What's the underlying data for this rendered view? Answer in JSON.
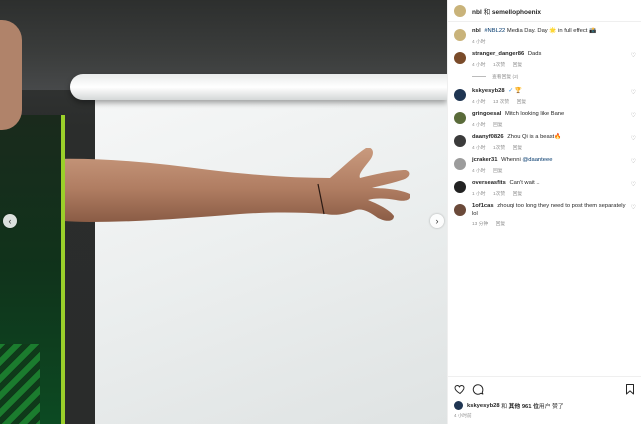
{
  "header": {
    "username": "nbl",
    "joiner": "和",
    "coauthor": "semellophoenix"
  },
  "caption": {
    "username": "nbl",
    "hashtag": "#NBL22",
    "text": " Media Day. Day 🌟 in full effect 📸",
    "time": "4 小时"
  },
  "comments": [
    {
      "user": "stranger_danger86",
      "text": "Dads",
      "time": "4 小时",
      "likes": "1次赞",
      "reply": "回复",
      "view_replies": "查看回复 (2)",
      "avatar_color": "#7a4b2a"
    },
    {
      "user": "kskyesyb28",
      "verified": "✓",
      "text": "🏆",
      "time": "4 小时",
      "likes": "13 次赞",
      "reply": "回复",
      "avatar_color": "#1f3552"
    },
    {
      "user": "gringoesal",
      "text": "Mitch looking like Bane",
      "time": "4 小时",
      "reply": "回复",
      "avatar_color": "#5a6b3a"
    },
    {
      "user": "daanyf0826",
      "text": "Zhou Qi is a beast🔥",
      "time": "4 小时",
      "likes": "1次赞",
      "reply": "回复",
      "avatar_color": "#3b3b3b"
    },
    {
      "user": "jcraker31",
      "text": "Whenni ",
      "mention": "@daanteee",
      "time": "4 小时",
      "reply": "回复",
      "avatar_color": "#9c9c9c"
    },
    {
      "user": "overseasfits",
      "text": "Can't wait ..",
      "time": "1 小时",
      "likes": "1次赞",
      "reply": "回复",
      "avatar_color": "#222222"
    },
    {
      "user": "1of1cas",
      "text": "zhouqi too long they need to post them separately lol",
      "time": "13 分钟",
      "reply": "回复",
      "avatar_color": "#6b4a3a"
    }
  ],
  "footer": {
    "liked_by_user": "kskyesyb28",
    "liked_joiner": "和",
    "liked_others": "其他 961 位",
    "liked_suffix": "用户 赞了",
    "post_time": "4 小时前"
  },
  "icons": {
    "heart": "heart-icon",
    "comment": "comment-icon",
    "bookmark": "bookmark-icon",
    "prev": "‹",
    "next": "›"
  },
  "colors": {
    "header_avatar": "#c9b37a",
    "accent_link": "#00376b",
    "muted": "#8e8e8e",
    "verified": "#3897f0"
  }
}
